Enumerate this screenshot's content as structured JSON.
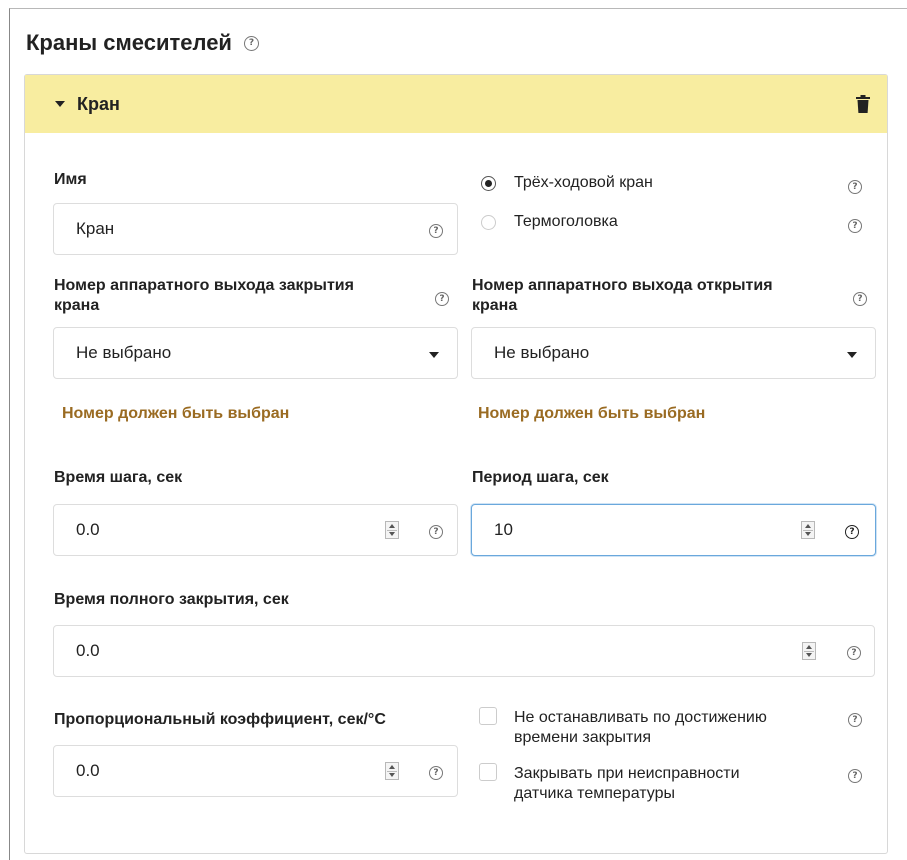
{
  "section": {
    "title": "Краны смесителей"
  },
  "card": {
    "title": "Кран"
  },
  "name": {
    "label": "Имя",
    "value": "Кран"
  },
  "valve_type": {
    "options": [
      {
        "label": "Трёх-ходовой кран",
        "selected": true
      },
      {
        "label": "Термоголовка",
        "selected": false
      }
    ]
  },
  "close_output": {
    "label_line1": "Номер аппаратного выхода закрытия",
    "label_line2": "крана",
    "value": "Не выбрано",
    "error": "Номер должен быть выбран"
  },
  "open_output": {
    "label_line1": "Номер аппаратного выхода открытия",
    "label_line2": "крана",
    "value": "Не выбрано",
    "error": "Номер должен быть выбран"
  },
  "step_time": {
    "label": "Время шага, сек",
    "value": "0.0"
  },
  "step_period": {
    "label": "Период шага, сек",
    "value": "10"
  },
  "full_close_time": {
    "label": "Время полного закрытия, сек",
    "value": "0.0"
  },
  "prop_coef": {
    "label": "Пропорциональный коэффициент, сек/°С",
    "value": "0.0"
  },
  "checkboxes": [
    {
      "line1": "Не останавливать по достижению",
      "line2": "времени закрытия",
      "checked": false
    },
    {
      "line1": "Закрывать при неисправности",
      "line2": "датчика температуры",
      "checked": false
    }
  ],
  "help_glyph": "?",
  "colors": {
    "header_bg": "#f8eda0",
    "error_text": "#9a6b22",
    "focus_border": "#6aa8dc"
  }
}
